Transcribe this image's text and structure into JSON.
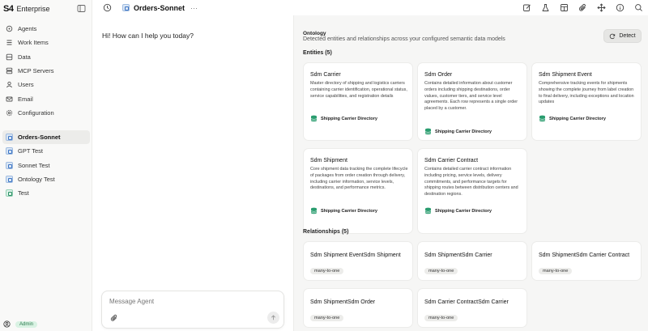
{
  "brand": {
    "logo": "S4",
    "name": "Enterprise"
  },
  "nav": [
    {
      "label": "Agents",
      "icon": "agents-icon"
    },
    {
      "label": "Work Items",
      "icon": "work-items-icon"
    },
    {
      "label": "Data",
      "icon": "database-icon"
    },
    {
      "label": "MCP Servers",
      "icon": "server-icon"
    },
    {
      "label": "Users",
      "icon": "user-icon"
    },
    {
      "label": "Email",
      "icon": "mail-icon"
    },
    {
      "label": "Configuration",
      "icon": "gear-icon"
    }
  ],
  "agents": [
    {
      "label": "Orders-Sonnet",
      "active": true
    },
    {
      "label": "GPT Test"
    },
    {
      "label": "Sonnet Test"
    },
    {
      "label": "Ontology Test"
    },
    {
      "label": "Test"
    }
  ],
  "user": {
    "badge": "Admin"
  },
  "topbar": {
    "agent_name": "Orders-Sonnet",
    "more": "···"
  },
  "chat": {
    "greeting": "Hi! How can I help you today?",
    "placeholder": "Message Agent"
  },
  "ontology": {
    "title": "Ontology",
    "subtitle": "Detected entities and relationships across your configured semantic data models",
    "detect_label": "Detect",
    "entities_title": "Entities (5)",
    "relationships_title": "Relationships (5)",
    "entities": [
      {
        "name": "Sdm Carrier",
        "description": "Master directory of shipping and logistics carriers containing carrier identification, operational status, service capabilities, and registration details",
        "source": "Shipping Carrier Directory"
      },
      {
        "name": "Sdm Order",
        "description": "Contains detailed information about customer orders including shipping destinations, order values, customer tiers, and service level agreements. Each row represents a single order placed by a customer.",
        "source": "Shipping Carrier Directory"
      },
      {
        "name": "Sdm Shipment Event",
        "description": "Comprehensive tracking events for shipments showing the complete journey from label creation to final delivery, including exceptions and location updates",
        "source": "Shipping Carrier Directory"
      },
      {
        "name": "Sdm Shipment",
        "description": "Core shipment data tracking the complete lifecycle of packages from order creation through delivery, including carrier information, service levels, destinations, and performance metrics.",
        "source": "Shipping Carrier Directory"
      },
      {
        "name": "Sdm Carrier Contract",
        "description": "Contains detailed carrier contract information including pricing, service levels, delivery commitments, and performance targets for shipping routes between distribution centers and destination regions.",
        "source": "Shipping Carrier Directory"
      }
    ],
    "relationships": [
      {
        "name": "Sdm Shipment EventSdm Shipment",
        "cardinality": "many-to-one"
      },
      {
        "name": "Sdm ShipmentSdm Carrier",
        "cardinality": "many-to-one"
      },
      {
        "name": "Sdm ShipmentSdm Carrier Contract",
        "cardinality": "many-to-one"
      },
      {
        "name": "Sdm ShipmentSdm Order",
        "cardinality": "many-to-one"
      },
      {
        "name": "Sdm Carrier ContractSdm Carrier",
        "cardinality": "many-to-one"
      }
    ]
  },
  "colors": {
    "accent": "#2a9d6f",
    "panel_bg": "#f6f6f5",
    "sidebar_bg": "#f9f9f8"
  }
}
